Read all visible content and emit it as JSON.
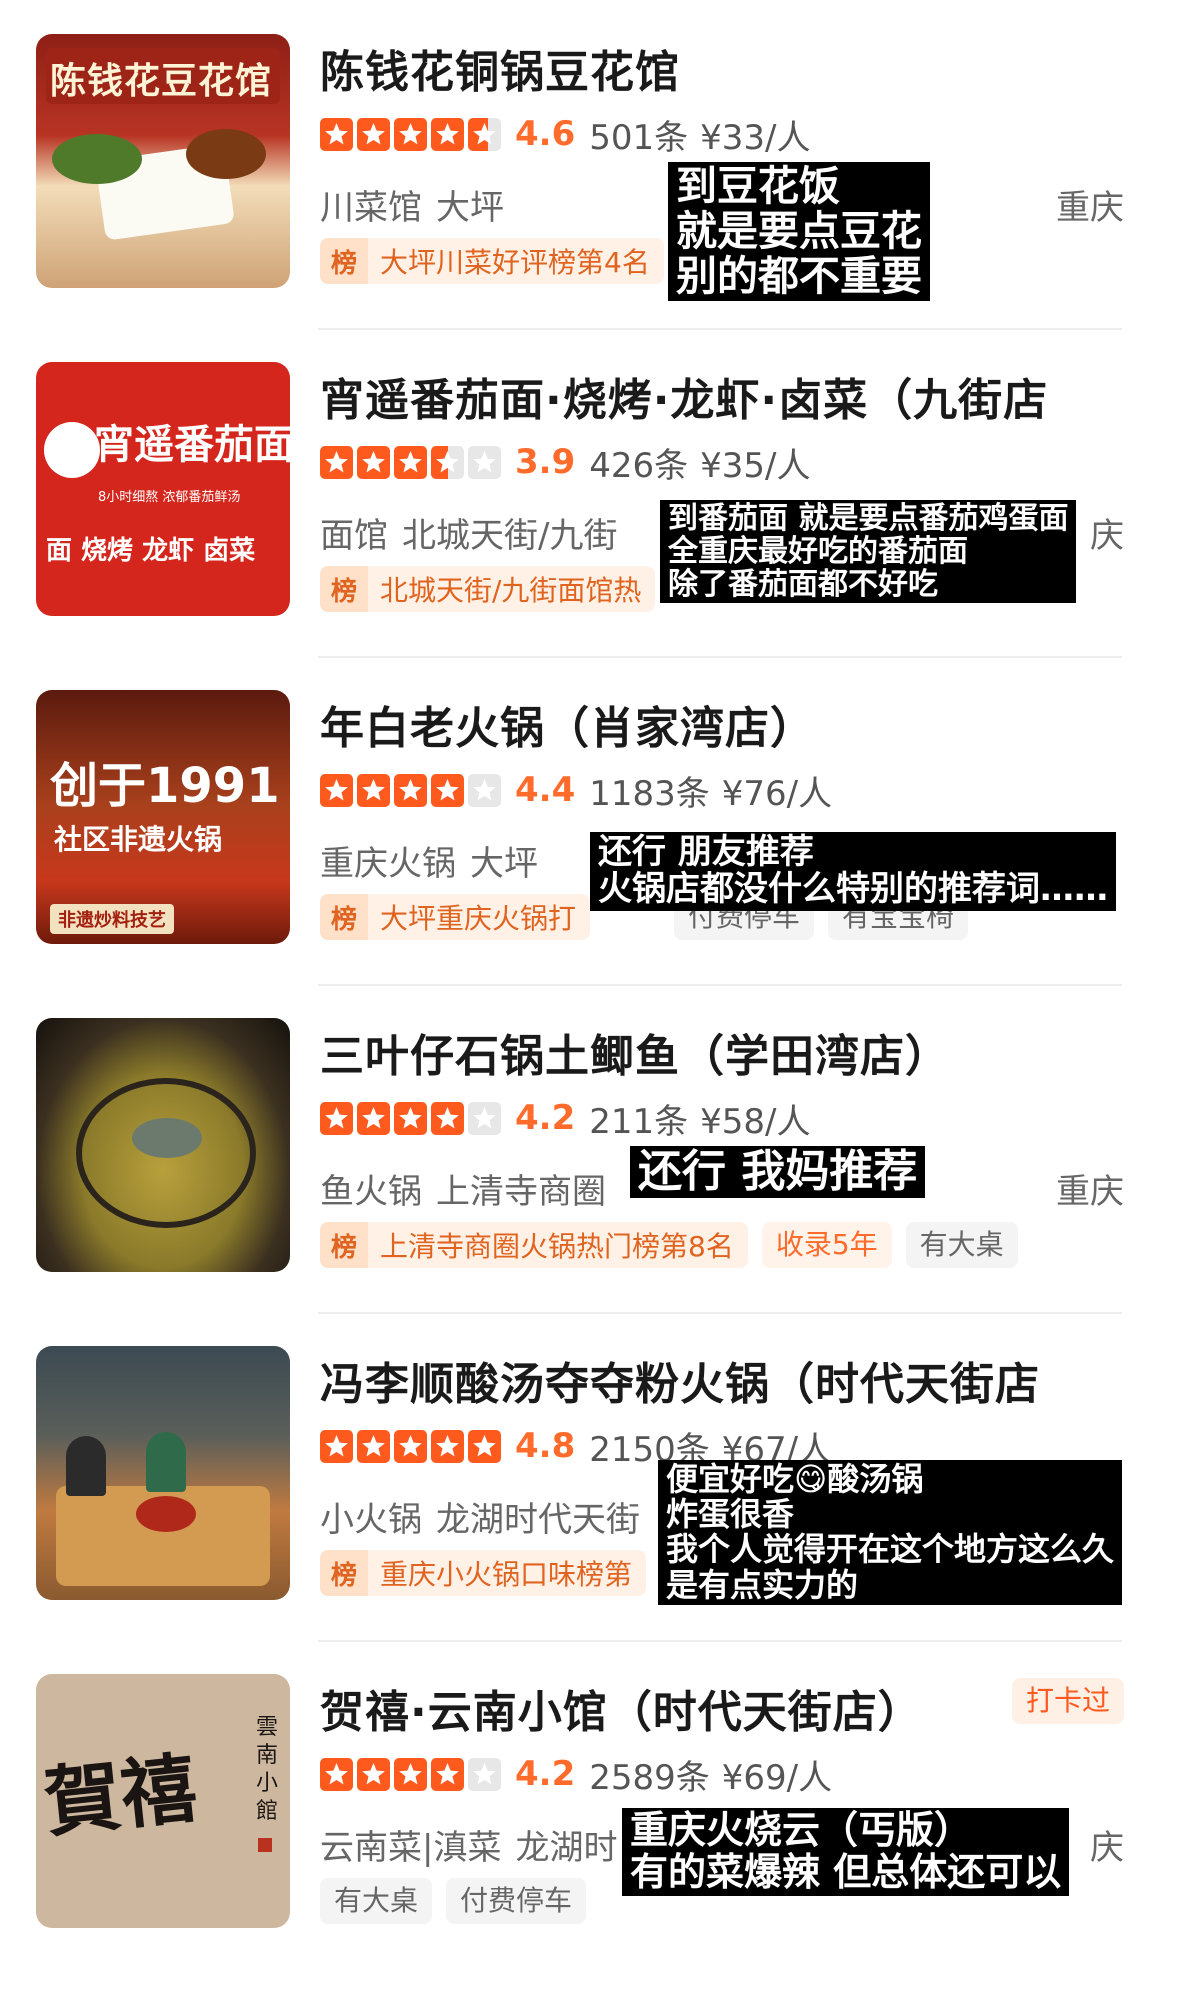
{
  "restaurants": [
    {
      "name": "陈钱花铜锅豆花馆",
      "rating": 4.6,
      "score": "4.6",
      "reviews": "501条",
      "price": "¥33/人",
      "category": "川菜馆",
      "area": "大坪",
      "city": "重庆",
      "rank": "大坪川菜好评榜第4名",
      "thumb_text": "陈钱花豆花馆",
      "comment": [
        "到豆花饭",
        "就是要点豆花",
        "别的都不重要"
      ]
    },
    {
      "name": "宵遥番茄面·烧烤·龙虾·卤菜（九街店",
      "rating": 3.5,
      "score": "3.9",
      "reviews": "426条",
      "price": "¥35/人",
      "category": "面馆",
      "area": "北城天街/九街",
      "city": "庆",
      "rank": "北城天街/九街面馆热",
      "thumb_text": "宵遥番茄面",
      "thumb_sub": "8小时细熬 浓郁番茄鲜汤",
      "thumb_bottom": "面 烧烤 龙虾 卤菜",
      "comment": [
        "到番茄面 就是要点番茄鸡蛋面",
        "全重庆最好吃的番茄面",
        "除了番茄面都不好吃"
      ]
    },
    {
      "name": "年白老火锅（肖家湾店）",
      "rating": 4.0,
      "score": "4.4",
      "reviews": "1183条",
      "price": "¥76/人",
      "category": "重庆火锅",
      "area": "大坪",
      "city": "",
      "rank": "大坪重庆火锅打",
      "thumb_text": "创于1991",
      "thumb_sub": "社区非遗火锅",
      "thumb_bottom": "非遗炒料技艺",
      "tags": [
        "付费停车",
        "有宝宝椅"
      ],
      "comment": [
        "还行 朋友推荐",
        "火锅店都没什么特别的推荐词……"
      ]
    },
    {
      "name": "三叶仔石锅土鲫鱼（学田湾店）",
      "rating": 4.0,
      "score": "4.2",
      "reviews": "211条",
      "price": "¥58/人",
      "category": "鱼火锅",
      "area": "上清寺商圈",
      "city": "重庆",
      "rank": "上清寺商圈火锅热门榜第8名",
      "tags_orange": [
        "收录5年"
      ],
      "tags": [
        "有大桌"
      ],
      "comment": [
        "还行 我妈推荐"
      ]
    },
    {
      "name": "冯李顺酸汤夺夺粉火锅（时代天街店",
      "rating": 5.0,
      "score": "4.8",
      "reviews": "2150条",
      "price": "¥67/人",
      "category": "小火锅",
      "area": "龙湖时代天街",
      "city": "",
      "rank": "重庆小火锅口味榜第",
      "comment": [
        "便宜好吃😋酸汤锅",
        "炸蛋很香",
        "我个人觉得开在这个地方这么久",
        "是有点实力的"
      ]
    },
    {
      "name": "贺禧·云南小馆（时代天街店）",
      "rating": 4.0,
      "score": "4.2",
      "reviews": "2589条",
      "price": "¥69/人",
      "category": "云南菜|滇菜",
      "area": "龙湖时",
      "city": "庆",
      "checkin": "打卡过",
      "tags": [
        "有大桌",
        "付费停车"
      ],
      "thumb_text": "賀禧",
      "thumb_sub": "雲南小館",
      "comment": [
        "重庆火烧云（丐版）",
        "有的菜爆辣 但总体还可以"
      ]
    }
  ],
  "colors": {
    "star": "#ff5a1e",
    "score": "#ff6b2b",
    "rank_text": "#e0641f"
  },
  "icons": {
    "star": "star-icon",
    "rank": "rank-badge-icon"
  },
  "rank_icon_label": "榜"
}
